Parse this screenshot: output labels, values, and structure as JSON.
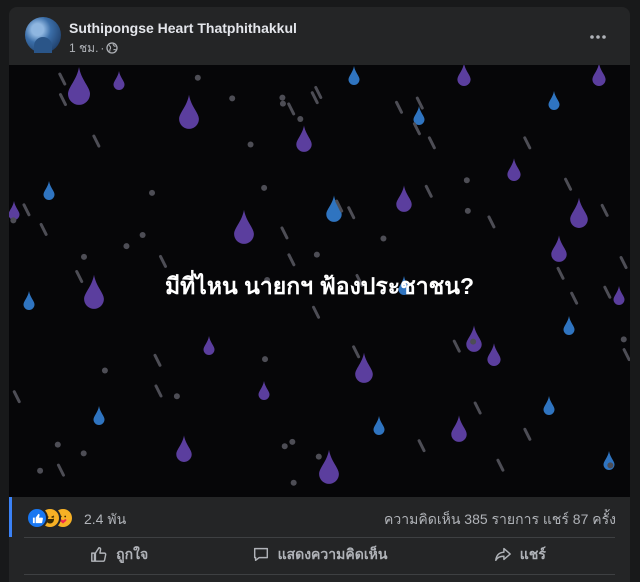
{
  "post": {
    "author": "Suthipongse Heart Thatphithakkul",
    "time": "1 ชม.",
    "separator": "·",
    "privacy_icon": "globe-icon",
    "more_icon": "more-horizontal-icon"
  },
  "media": {
    "text": "มีที่ไหน นายกฯ ฟ้องประชาชน?",
    "background": "#060608",
    "drop_colors": [
      "#5b3e9e",
      "#2f74c0",
      "#4d4d55"
    ]
  },
  "stats": {
    "reactions": [
      "like",
      "haha",
      "care"
    ],
    "reaction_count": "2.4 พัน",
    "comments": "ความคิดเห็น 385 รายการ",
    "shares": "แชร์ 87 ครั้ง"
  },
  "actions": {
    "like": "ถูกใจ",
    "comment": "แสดงความคิดเห็น",
    "share": "แชร์"
  },
  "colors": {
    "card": "#242526",
    "text_primary": "#e4e6eb",
    "text_secondary": "#b0b3b8",
    "accent": "#1877f2"
  }
}
